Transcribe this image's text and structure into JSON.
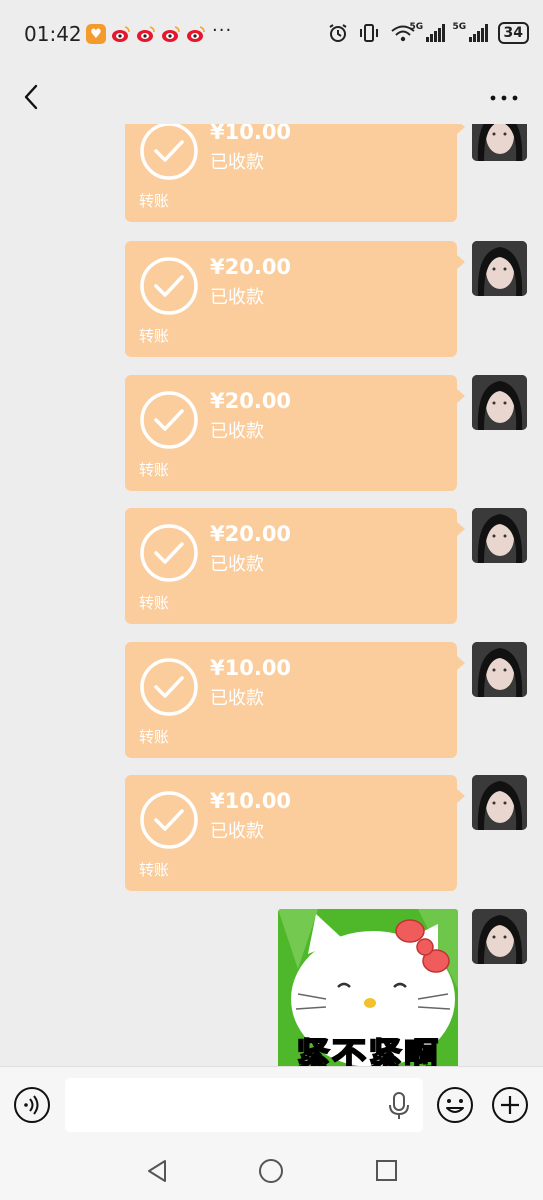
{
  "status_bar": {
    "time": "01:42",
    "battery": "34",
    "network_1": "5G",
    "network_2": "5G"
  },
  "nav": {
    "title": ""
  },
  "transfers": [
    {
      "amount": "¥10.00",
      "status": "已收款",
      "label": "转账"
    },
    {
      "amount": "¥20.00",
      "status": "已收款",
      "label": "转账"
    },
    {
      "amount": "¥20.00",
      "status": "已收款",
      "label": "转账"
    },
    {
      "amount": "¥20.00",
      "status": "已收款",
      "label": "转账"
    },
    {
      "amount": "¥10.00",
      "status": "已收款",
      "label": "转账"
    },
    {
      "amount": "¥10.00",
      "status": "已收款",
      "label": "转账"
    }
  ],
  "sticker": {
    "caption": "紧不紧啊"
  },
  "input_bar": {
    "placeholder": "",
    "value": ""
  },
  "colors": {
    "transfer_bubble": "#fbcd9d",
    "background": "#ededed"
  }
}
